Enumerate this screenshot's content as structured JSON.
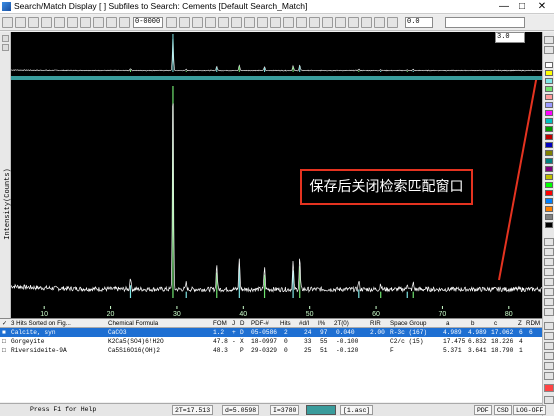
{
  "window": {
    "title": "Search/Match Display [ ] Subfiles to Search: Cements [Default Search_Match]",
    "minimize": "—",
    "maximize": "□",
    "close": "✕"
  },
  "toolbar": {
    "range_left": "0-0000",
    "range_right": "0.0",
    "zoom_value": "3.0"
  },
  "plot": {
    "ylabel": "Intensity(Counts)",
    "annotation": "保存后关闭检索匹配窗口",
    "colors": {
      "trace": "#ffffff",
      "stick_green": "#6fe36f",
      "stick_cyan": "#7fe6e6",
      "background": "#000000",
      "divider": "#3a9c9c",
      "annotation_border": "#e53320",
      "arrow": "#e53320"
    }
  },
  "chart_data": {
    "type": "line",
    "xlabel": "",
    "ylabel": "Intensity(Counts)",
    "xlim": [
      5,
      85
    ],
    "x_ticks": [
      10,
      20,
      30,
      40,
      50,
      60,
      70,
      80
    ],
    "peaks": [
      {
        "x": 23.0,
        "y": 6
      },
      {
        "x": 29.4,
        "y": 100
      },
      {
        "x": 31.4,
        "y": 3
      },
      {
        "x": 36.0,
        "y": 12
      },
      {
        "x": 39.4,
        "y": 15
      },
      {
        "x": 43.2,
        "y": 11
      },
      {
        "x": 47.5,
        "y": 13
      },
      {
        "x": 48.5,
        "y": 15
      },
      {
        "x": 57.4,
        "y": 4
      },
      {
        "x": 60.7,
        "y": 3
      },
      {
        "x": 64.7,
        "y": 3
      },
      {
        "x": 65.6,
        "y": 3
      }
    ]
  },
  "table": {
    "headers": [
      "✓",
      "3 Hits Sorted on Fig...",
      "Chemical Formula",
      "FOM",
      "J",
      "D",
      "PDF-#",
      "Hits",
      "#d/I",
      "I%",
      "2T(0)",
      "RIR",
      "Space Group",
      "a",
      "b",
      "c",
      "Z",
      "RDM"
    ],
    "rows": [
      {
        "name": "Calcite, syn",
        "formula": "CaCO3",
        "fom": "1.2",
        "j": "+",
        "d": "D",
        "pdf": "05-0586",
        "hits": "2",
        "dI": "24",
        "ip": "97",
        "t0": "0.040",
        "rir": "2.00",
        "sg": "R-3c (167)",
        "a": "4.989",
        "b": "4.989",
        "c": "17.062",
        "z": "6",
        "rdm": "6",
        "selected": true
      },
      {
        "name": "Gorgeyite",
        "formula": "K2Ca5(SO4)6!H2O",
        "fom": "47.8",
        "j": "-",
        "d": "X",
        "pdf": "18-0997",
        "hits": "0",
        "dI": "33",
        "ip": "55",
        "t0": "-0.100",
        "rir": "",
        "sg": "C2/c (15)",
        "a": "17.475",
        "b": "6.832",
        "c": "18.226",
        "z": "4",
        "rdm": "",
        "selected": false
      },
      {
        "name": "Riversideite-9A",
        "formula": "Ca5Si6O16(OH)2",
        "fom": "48.3",
        "j": "",
        "d": "P",
        "pdf": "29-0329",
        "hits": "0",
        "dI": "25",
        "ip": "51",
        "t0": "-0.120",
        "rir": "",
        "sg": "F",
        "a": "5.371",
        "b": "3.641",
        "c": "18.790",
        "z": "1",
        "rdm": "",
        "selected": false
      }
    ]
  },
  "status": {
    "help": "Press F1 for Help",
    "two_theta": "2T=17.513",
    "d": "d=5.0598",
    "intensity": "I=3780",
    "file": "[1.asc]",
    "pdf": "PDF",
    "csd": "CSD",
    "log": "LOG-OFF"
  }
}
